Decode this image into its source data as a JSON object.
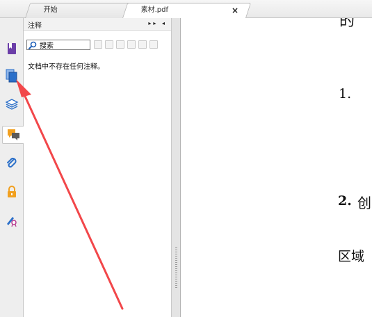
{
  "tabs": [
    {
      "label": "开始"
    },
    {
      "label": "素材.pdf"
    }
  ],
  "tab_close_glyph": "×",
  "panel": {
    "title": "注释",
    "controls": "▸▸ ◂",
    "search_label": "搜索",
    "empty_message": "文档中不存在任何注释。"
  },
  "sidebar_icons": [
    "bookmark-icon",
    "pages-thumbnail-icon",
    "layers-icon",
    "comments-icon",
    "attachments-icon",
    "security-lock-icon",
    "signature-icon"
  ],
  "document": {
    "fragment_top": "的",
    "fragment_1": "1.",
    "fragment_2": "2.",
    "fragment_2_char": "创",
    "fragment_region": "区域"
  },
  "colors": {
    "arrow": "#f2474a",
    "accent_blue": "#2a6fc9",
    "accent_orange": "#f1a020",
    "purple": "#6b3ea8"
  }
}
